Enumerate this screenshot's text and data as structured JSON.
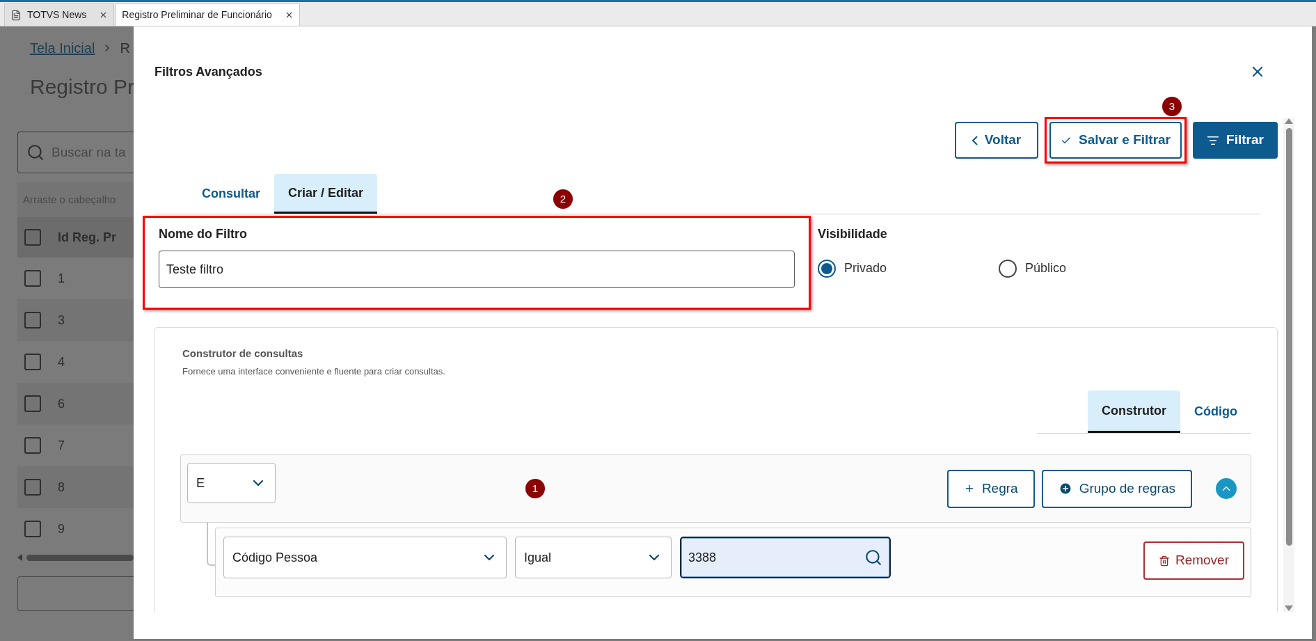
{
  "browser_tabs": [
    {
      "label": "TOTVS News",
      "selected": false
    },
    {
      "label": "Registro Preliminar de Funcionário",
      "selected": true
    }
  ],
  "background_page": {
    "breadcrumb": [
      "Tela Inicial",
      "R"
    ],
    "title": "Registro Pr",
    "search_placeholder": "Buscar na ta",
    "group_hint": "Arraste o cabeçalho",
    "column_1": "Id Reg. Pr",
    "header_checked": false,
    "rows": [
      {
        "id": "1",
        "checked": false
      },
      {
        "id": "3",
        "checked": false
      },
      {
        "id": "4",
        "checked": false
      },
      {
        "id": "6",
        "checked": false
      },
      {
        "id": "7",
        "checked": false
      },
      {
        "id": "8",
        "checked": false
      },
      {
        "id": "9",
        "checked": false
      }
    ]
  },
  "dialog": {
    "title": "Filtros Avançados",
    "actions": [
      {
        "label": "Voltar",
        "kind": "back",
        "highlighted": false
      },
      {
        "label": "Salvar e Filtrar",
        "kind": "save",
        "highlighted": true,
        "callout": "3"
      },
      {
        "label": "Filtrar",
        "kind": "primary",
        "highlighted": false
      }
    ],
    "tabs": [
      {
        "label": "Consultar",
        "selected": false
      },
      {
        "label": "Criar / Editar",
        "selected": true
      }
    ],
    "filter_name": {
      "label": "Nome do Filtro",
      "value": "Teste filtro",
      "highlighted": true,
      "callout": "2"
    },
    "visibility": {
      "label": "Visibilidade",
      "options": [
        {
          "label": "Privado",
          "selected": true
        },
        {
          "label": "Público",
          "selected": false
        }
      ]
    },
    "query_builder": {
      "title": "Construtor de consultas",
      "description": "Fornece uma interface conveniente e fluente para criar consultas.",
      "tabs": [
        {
          "label": "Construtor",
          "selected": true
        },
        {
          "label": "Código",
          "selected": false
        }
      ],
      "group": {
        "operator": "E",
        "expanded": true,
        "callout": "1",
        "buttons": [
          {
            "label": "Regra",
            "kind": "add"
          },
          {
            "label": "Grupo de regras",
            "kind": "add-group"
          }
        ]
      },
      "rules": [
        {
          "field": "Código Pessoa",
          "comparison": "Igual",
          "value": "3388",
          "focused": true,
          "remove_label": "Remover"
        }
      ]
    }
  }
}
